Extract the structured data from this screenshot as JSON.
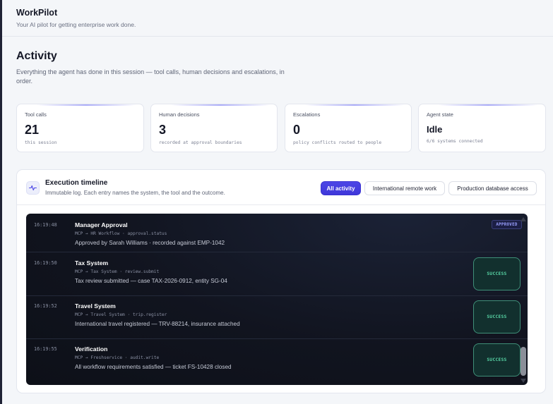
{
  "app": {
    "name": "WorkPilot",
    "tagline": "Your AI pilot for getting enterprise work done."
  },
  "page": {
    "title": "Activity",
    "description": "Everything the agent has done in this session — tool calls, human decisions and escalations, in order."
  },
  "stats": [
    {
      "label": "Tool calls",
      "value": "21",
      "sub": "this session"
    },
    {
      "label": "Human decisions",
      "value": "3",
      "sub": "recorded at approval boundaries"
    },
    {
      "label": "Escalations",
      "value": "0",
      "sub": "policy conflicts routed to people"
    },
    {
      "label": "Agent state",
      "value": "Idle",
      "sub": "6/6 systems connected"
    }
  ],
  "timeline": {
    "icon": "activity-pulse-icon",
    "title": "Execution timeline",
    "subtitle": "Immutable log. Each entry names the system, the tool and the outcome.",
    "filters": [
      {
        "label": "All activity",
        "active": true
      },
      {
        "label": "International remote work",
        "active": false
      },
      {
        "label": "Production database access",
        "active": false
      }
    ],
    "entries": [
      {
        "time": "16:19:48",
        "title": "Manager Approval",
        "route": "MCP → HR Workflow · approval.status",
        "detail": "Approved by Sarah Williams · recorded against EMP-1042",
        "status": "APPROVED"
      },
      {
        "time": "16:19:50",
        "title": "Tax System",
        "route": "MCP → Tax System · review.submit",
        "detail": "Tax review submitted — case TAX-2026-0912, entity SG-04",
        "status": "SUCCESS"
      },
      {
        "time": "16:19:52",
        "title": "Travel System",
        "route": "MCP → Travel System · trip.register",
        "detail": "International travel registered — TRV-88214, insurance attached",
        "status": "SUCCESS"
      },
      {
        "time": "16:19:55",
        "title": "Verification",
        "route": "MCP → Freshservice · audit.write",
        "detail": "All workflow requirements satisfied — ticket FS-10428 closed",
        "status": "SUCCESS"
      }
    ]
  },
  "colors": {
    "accent": "#4c46e6",
    "success": "#58d6a6",
    "log_background": "#11141f"
  }
}
